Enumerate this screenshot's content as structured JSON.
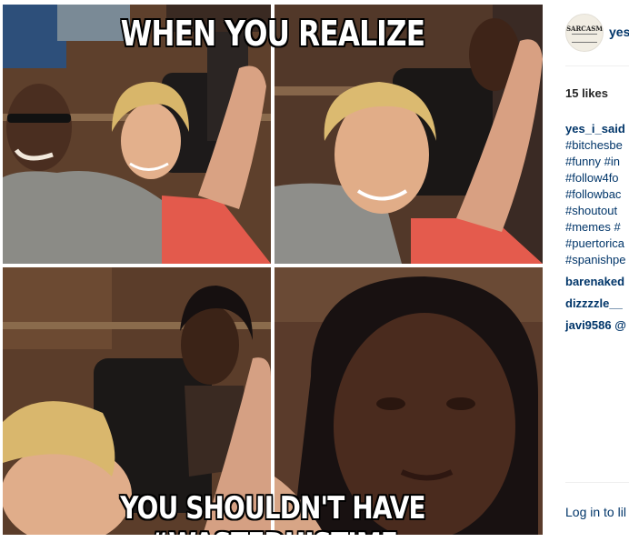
{
  "meme": {
    "caption_top": "WHEN YOU REALIZE",
    "caption_bottom": "YOU SHOULDN'T HAVE #WASTEDHISTIME"
  },
  "post": {
    "avatar_text": "SARCASM",
    "username": "yes",
    "likes": "15 likes",
    "comments": [
      {
        "text": "yes_i_said",
        "user": true
      },
      {
        "text": "#bitchesbe",
        "user": false
      },
      {
        "text": "#funny #in",
        "user": false
      },
      {
        "text": "#follow4fo",
        "user": false
      },
      {
        "text": "#followbac",
        "user": false
      },
      {
        "text": "#shoutout",
        "user": false
      },
      {
        "text": "#memes #",
        "user": false
      },
      {
        "text": "#puertorica",
        "user": false
      },
      {
        "text": "#spanishpe",
        "user": false
      },
      {
        "text": "barenaked",
        "user": true
      },
      {
        "text": "dizzzzle__",
        "user": true
      },
      {
        "text": "javi9586 @",
        "user": true
      }
    ],
    "login": "Log in to lil"
  },
  "colors": {
    "link": "#003569",
    "caption": "#ffffff"
  }
}
